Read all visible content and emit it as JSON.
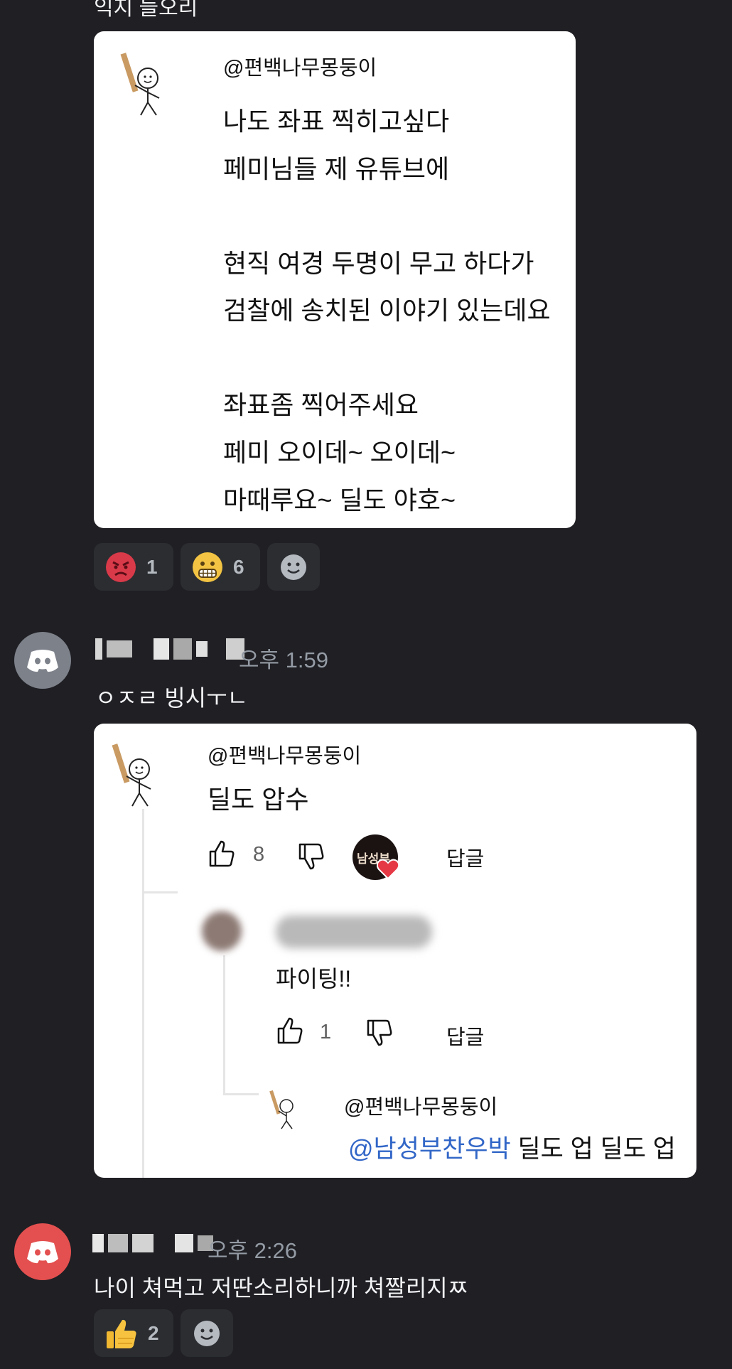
{
  "top_cut_text": "익지 들오리",
  "post1": {
    "handle": "@편백나무몽둥이",
    "lines": [
      "나도 좌표 찍히고싶다",
      "페미님들 제 유튜브에",
      "",
      "현직 여경 두명이 무고 하다가",
      "검찰에 송치된 이야기 있는데요",
      "",
      "좌표좀 찍어주세요",
      "페미 오이데~ 오이데~",
      "마때루요~ 딜도 야호~"
    ]
  },
  "reactions1": [
    {
      "emoji": "angry-face-icon",
      "count": "1"
    },
    {
      "emoji": "grimacing-face-icon",
      "count": "6"
    }
  ],
  "message1": {
    "time": "오후 1:59",
    "text": "ㅇㅈㄹ 빙시ㅜㄴ",
    "avatar_color": "#7d818a"
  },
  "post2": {
    "comment_handle": "@편백나무몽둥이",
    "comment_text": "딜도 압수",
    "likes": "8",
    "reply_label": "답글",
    "heart_avatar_text": "남성부",
    "reply1_text": "파이팅!!",
    "reply1_likes": "1",
    "reply1_label": "답글",
    "reply2_handle": "@편백나무몽둥이",
    "reply2_mention": "@남성부찬우박",
    "reply2_text": " 딜도 업 딜도 업"
  },
  "message2": {
    "time": "오후 2:26",
    "text": "나이 쳐먹고 저딴소리하니까 쳐짤리지ㅉ",
    "avatar_color": "#e3504f"
  },
  "reactions2": [
    {
      "emoji": "thumbs-up-icon",
      "count": "2"
    }
  ],
  "colors": {
    "background": "#1f1f24",
    "reaction_bg": "#2b2d31",
    "mention_blue": "#3166c7"
  }
}
